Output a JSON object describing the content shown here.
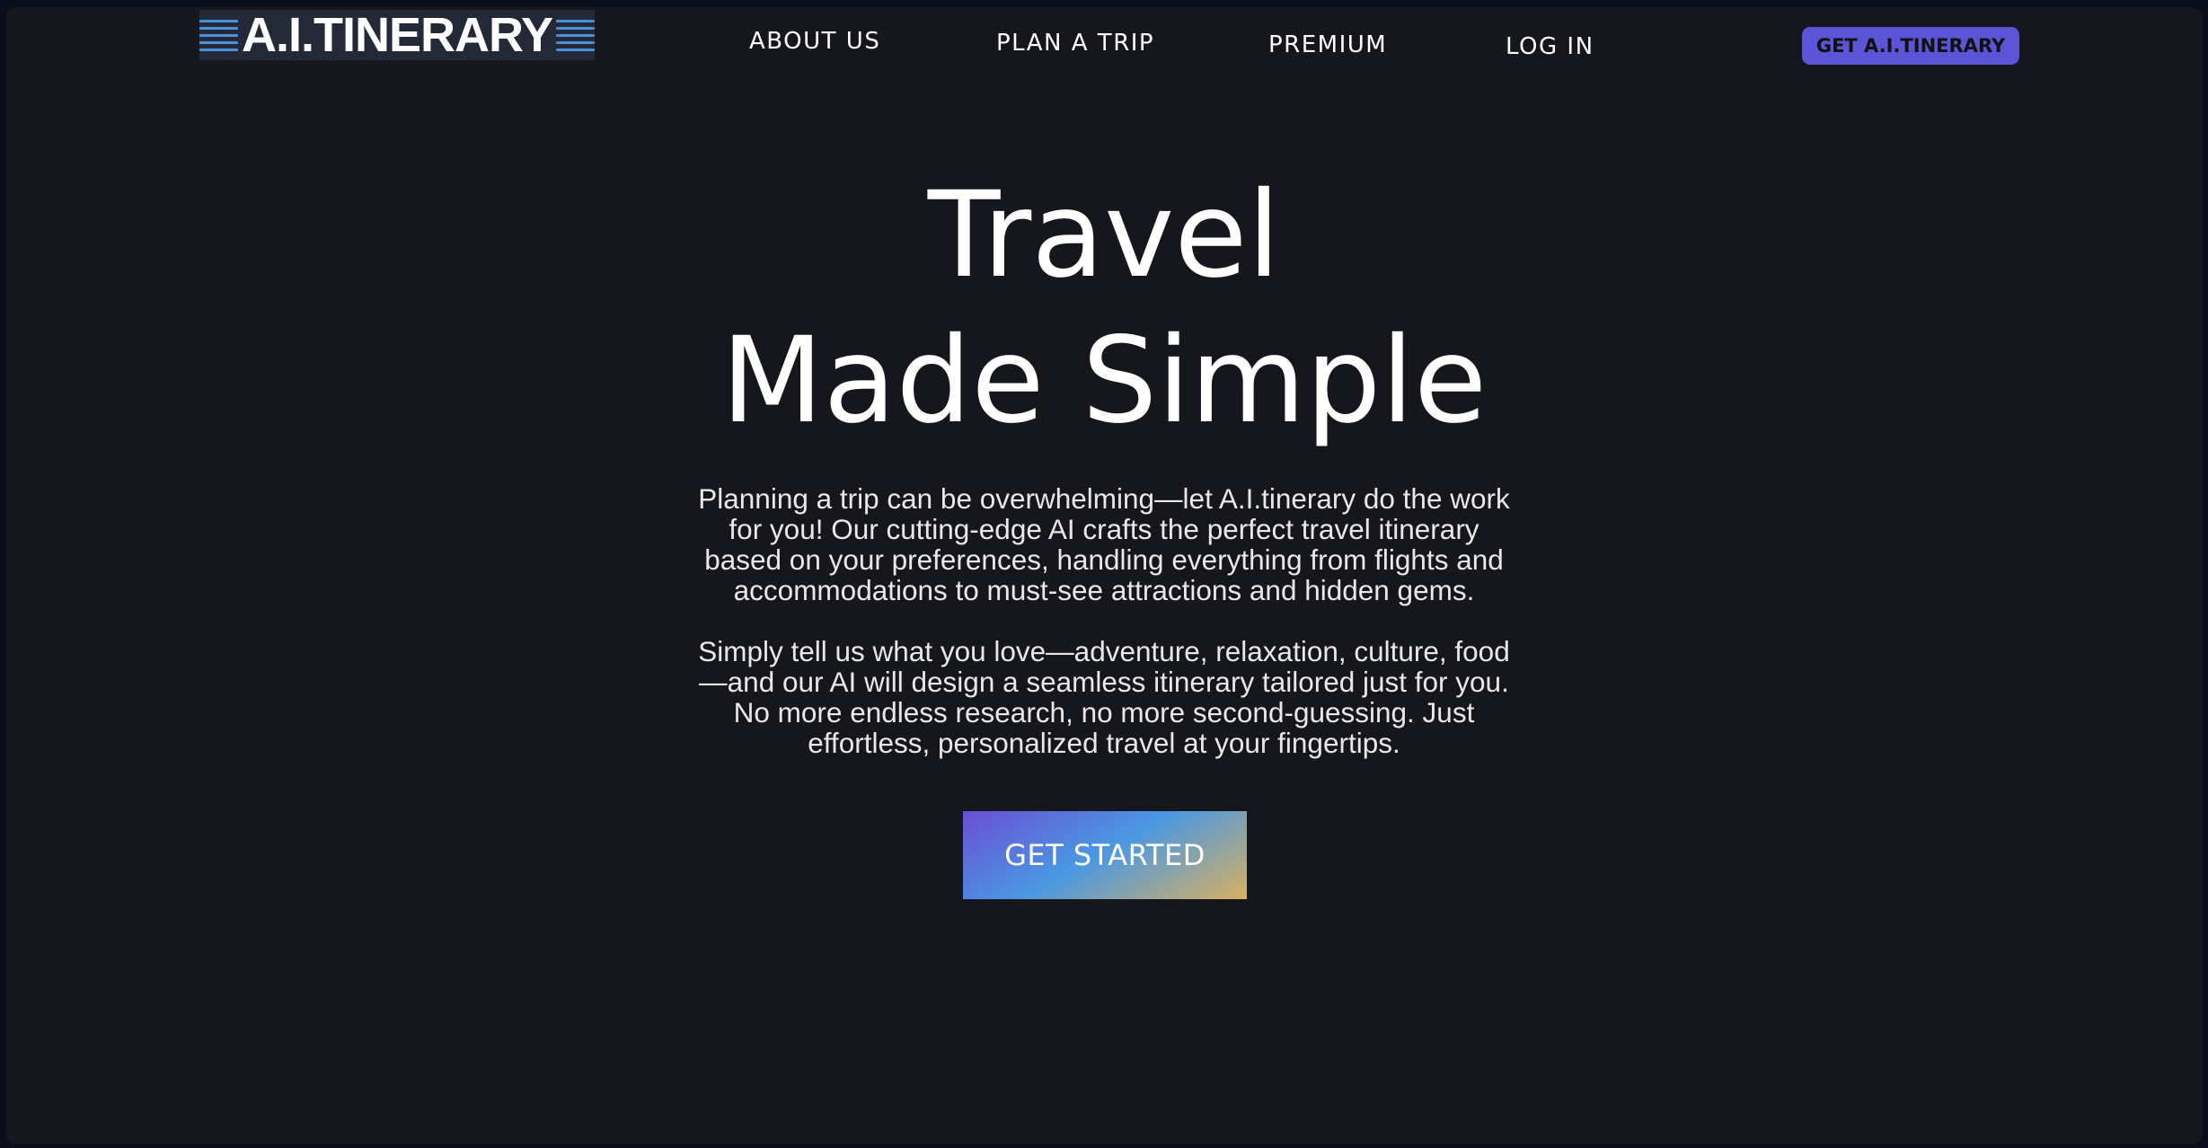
{
  "header": {
    "logo_text": "A.I.TINERARY",
    "nav": {
      "about": "ABOUT US",
      "plan": "PLAN A TRIP",
      "premium": "PREMIUM",
      "login": "LOG IN"
    },
    "cta": "GET A.I.TINERARY"
  },
  "hero": {
    "title_line_1": "Travel",
    "title_line_2": "Made Simple",
    "paragraph_1": "Planning a trip can be overwhelming—let A.I.tinerary do the work for you! Our cutting-edge AI crafts the perfect travel itinerary based on your preferences, handling everything from flights and accommodations to must-see attractions and hidden gems.",
    "paragraph_2": "Simply tell us what you love—adventure, relaxation, culture, food—and our AI will design a seamless itinerary tailored just for you. No more endless research, no more second-guessing. Just effortless, personalized travel at your fingertips.",
    "button": "GET STARTED"
  },
  "colors": {
    "page_background": "#15171c",
    "outer_background": "#0a0d1a",
    "accent": "#5b54d6",
    "logo_background": "#242938",
    "logo_lines": "#4a90d9",
    "gradient_start": "#6a4fd4",
    "gradient_mid": "#4a98e2",
    "gradient_end": "#d8b061"
  }
}
